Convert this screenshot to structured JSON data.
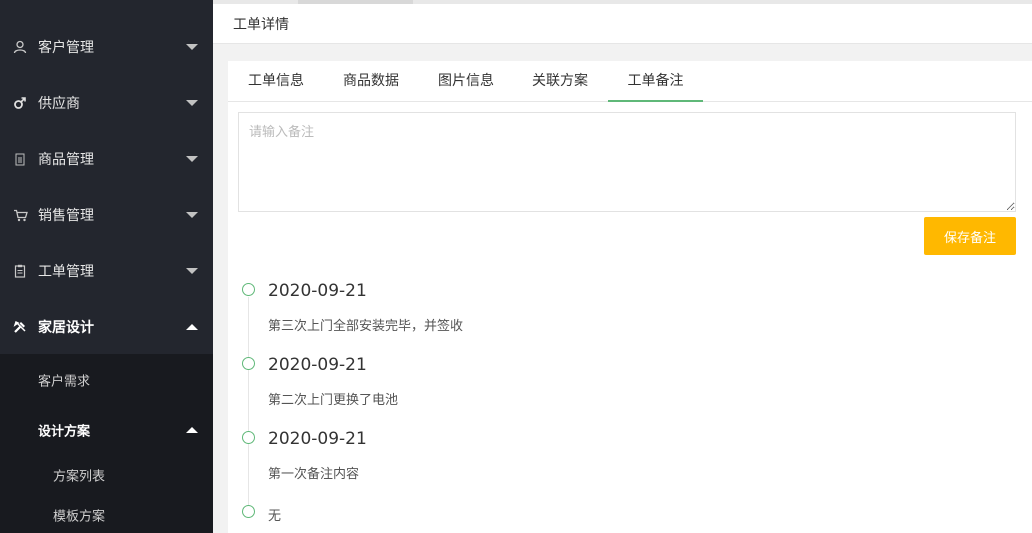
{
  "sidebar": {
    "items": [
      {
        "label": "客户管理",
        "icon": "user-icon",
        "expanded": false
      },
      {
        "label": "供应商",
        "icon": "male-icon",
        "expanded": false
      },
      {
        "label": "商品管理",
        "icon": "document-icon",
        "expanded": false
      },
      {
        "label": "销售管理",
        "icon": "cart-icon",
        "expanded": false
      },
      {
        "label": "工单管理",
        "icon": "clipboard-icon",
        "expanded": false
      },
      {
        "label": "家居设计",
        "icon": "tools-icon",
        "expanded": true
      }
    ],
    "submenu": [
      {
        "label": "客户需求"
      },
      {
        "label": "设计方案",
        "expanded": true
      },
      {
        "label": "方案列表"
      },
      {
        "label": "模板方案"
      }
    ]
  },
  "header": {
    "title": "工单详情"
  },
  "tabs": [
    {
      "label": "工单信息",
      "active": false
    },
    {
      "label": "商品数据",
      "active": false
    },
    {
      "label": "图片信息",
      "active": false
    },
    {
      "label": "关联方案",
      "active": false
    },
    {
      "label": "工单备注",
      "active": true
    }
  ],
  "remark": {
    "placeholder": "请输入备注",
    "value": "",
    "save_label": "保存备注"
  },
  "timeline": [
    {
      "date": "2020-09-21",
      "text": "第三次上门全部安装完毕，并签收"
    },
    {
      "date": "2020-09-21",
      "text": "第二次上门更换了电池"
    },
    {
      "date": "2020-09-21",
      "text": "第一次备注内容"
    },
    {
      "date": "",
      "text": "无"
    }
  ],
  "colors": {
    "sidebar_bg": "#23262e",
    "accent": "#5fb878",
    "button": "#ffb800"
  }
}
